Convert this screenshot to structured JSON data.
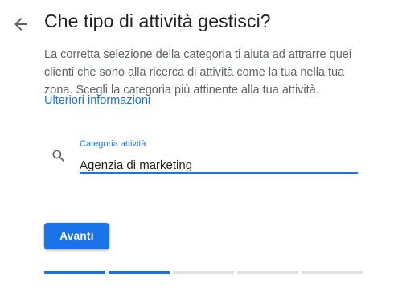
{
  "header": {
    "title": "Che tipo di attività gestisci?"
  },
  "description": {
    "text": "La corretta selezione della categoria ti aiuta ad attrarre quei clienti che sono alla ricerca di attività come la tua nella tua zona. Scegli la categoria più attinente alla tua attività.",
    "link_label": "Ulteriori informazioni"
  },
  "category_field": {
    "label": "Categoria attività",
    "value": "Agenzia di marketing",
    "icon": "search-icon"
  },
  "actions": {
    "next_label": "Avanti"
  },
  "progress": {
    "total_steps": 5,
    "completed_steps": 2
  },
  "colors": {
    "accent": "#1a73e8",
    "title_text": "#202124",
    "body_text": "#5f6368",
    "progress_inactive": "#e0e0e0"
  }
}
